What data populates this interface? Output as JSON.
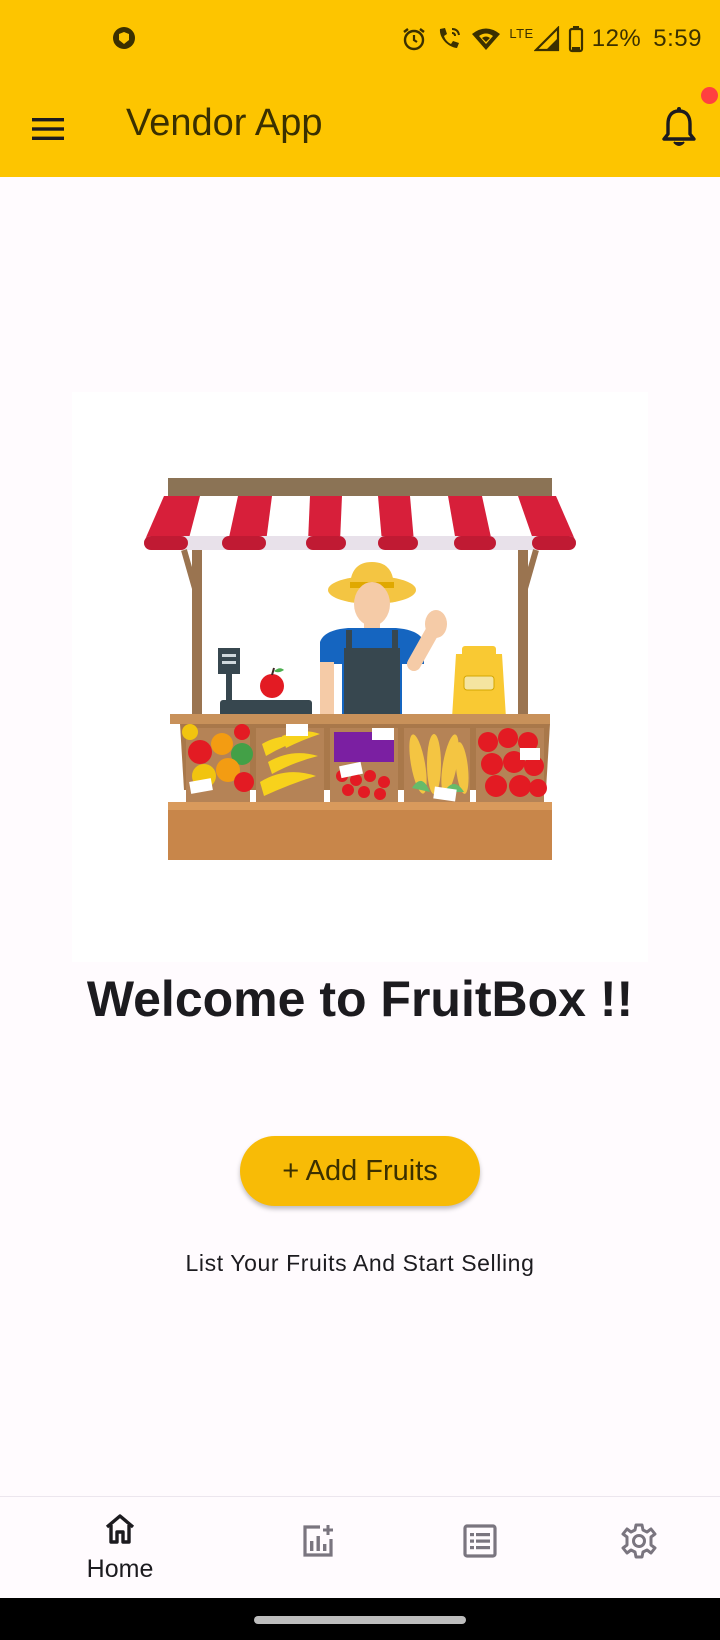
{
  "status_bar": {
    "battery": "12%",
    "time": "5:59",
    "network": "LTE"
  },
  "app_bar": {
    "title": "Vendor App"
  },
  "main": {
    "welcome": "Welcome to FruitBox !!",
    "add_button": "+ Add Fruits",
    "subtitle": "List Your Fruits And Start Selling"
  },
  "bottom_nav": {
    "items": [
      {
        "label": "Home",
        "icon": "home-icon",
        "active": true
      },
      {
        "label": "",
        "icon": "analytics-add-icon",
        "active": false
      },
      {
        "label": "",
        "icon": "list-icon",
        "active": false
      },
      {
        "label": "",
        "icon": "settings-icon",
        "active": false
      }
    ]
  },
  "colors": {
    "app_bar": "#fdc500",
    "button": "#f8bb06",
    "notification_dot": "#ff4040",
    "background": "#fffbfe"
  }
}
